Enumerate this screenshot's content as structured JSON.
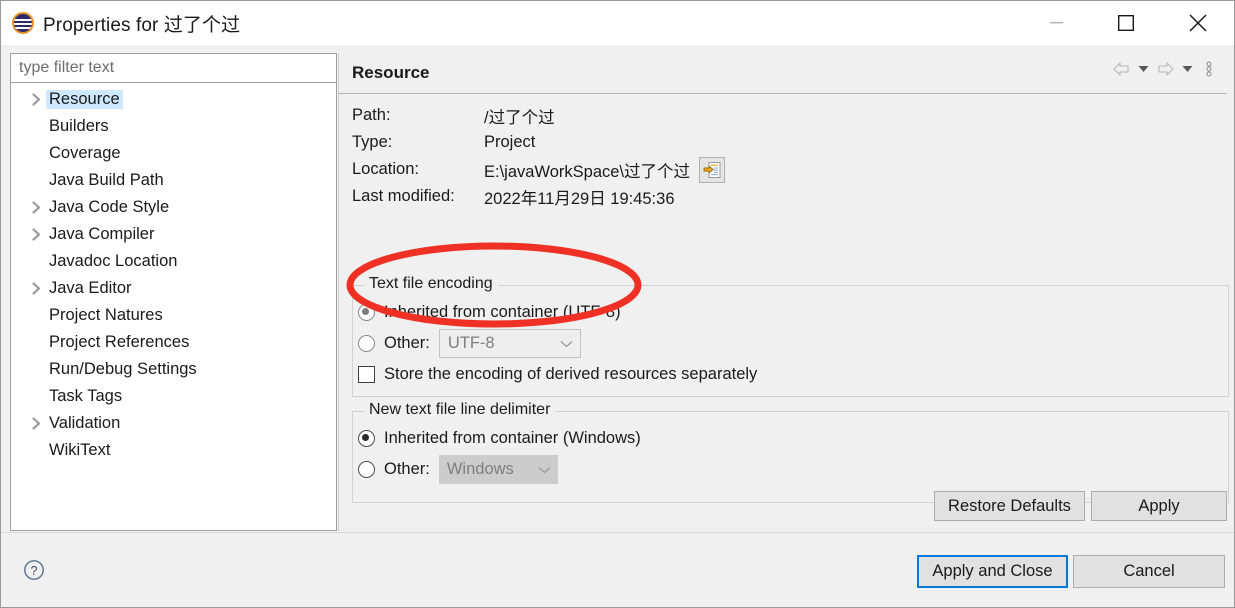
{
  "window": {
    "title": "Properties for 过了个过",
    "logo_icon": "eclipse-logo-icon",
    "controls": {
      "minimize": "minimize-icon",
      "maximize": "maximize-icon",
      "close": "close-icon"
    }
  },
  "sidebar": {
    "filter_placeholder": "type filter text",
    "filter_value": "",
    "items": [
      {
        "label": "Resource",
        "expandable": true,
        "selected": true
      },
      {
        "label": "Builders",
        "expandable": false,
        "selected": false
      },
      {
        "label": "Coverage",
        "expandable": false,
        "selected": false
      },
      {
        "label": "Java Build Path",
        "expandable": false,
        "selected": false
      },
      {
        "label": "Java Code Style",
        "expandable": true,
        "selected": false
      },
      {
        "label": "Java Compiler",
        "expandable": true,
        "selected": false
      },
      {
        "label": "Javadoc Location",
        "expandable": false,
        "selected": false
      },
      {
        "label": "Java Editor",
        "expandable": true,
        "selected": false
      },
      {
        "label": "Project Natures",
        "expandable": false,
        "selected": false
      },
      {
        "label": "Project References",
        "expandable": false,
        "selected": false
      },
      {
        "label": "Run/Debug Settings",
        "expandable": false,
        "selected": false
      },
      {
        "label": "Task Tags",
        "expandable": false,
        "selected": false
      },
      {
        "label": "Validation",
        "expandable": true,
        "selected": false
      },
      {
        "label": "WikiText",
        "expandable": false,
        "selected": false
      }
    ]
  },
  "content": {
    "title": "Resource",
    "toolbar": {
      "back": "back-arrow-icon",
      "back_menu": "chevron-down-icon",
      "forward": "forward-arrow-icon",
      "forward_menu": "chevron-down-icon",
      "more": "more-vertical-icon"
    },
    "properties": [
      {
        "label": "Path:",
        "value": "/过了个过"
      },
      {
        "label": "Type:",
        "value": "Project"
      },
      {
        "label": "Location:",
        "value": "E:\\javaWorkSpace\\过了个过"
      },
      {
        "label": "Last modified:",
        "value": "2022年11月29日 19:45:36"
      }
    ],
    "location_browse_icon": "open-external-icon",
    "encoding_group": {
      "title": "Text file encoding",
      "inherited_label": "Inherited from container (UTF-8)",
      "inherited_checked": true,
      "other_label": "Other:",
      "other_checked": false,
      "other_value": "UTF-8",
      "other_disabled": true,
      "store_separately_label": "Store the encoding of derived resources separately",
      "store_separately_checked": false
    },
    "delimiter_group": {
      "title": "New text file line delimiter",
      "inherited_label": "Inherited from container (Windows)",
      "inherited_checked": true,
      "other_label": "Other:",
      "other_checked": false,
      "other_value": "Windows",
      "other_disabled": true
    },
    "restore_defaults_label": "Restore Defaults",
    "apply_label": "Apply"
  },
  "footer": {
    "help_icon": "help-circle-icon",
    "apply_and_close_label": "Apply and Close",
    "cancel_label": "Cancel"
  },
  "annotation": {
    "shape": "ellipse",
    "color": "#ee3124",
    "stroke_width": 7
  }
}
